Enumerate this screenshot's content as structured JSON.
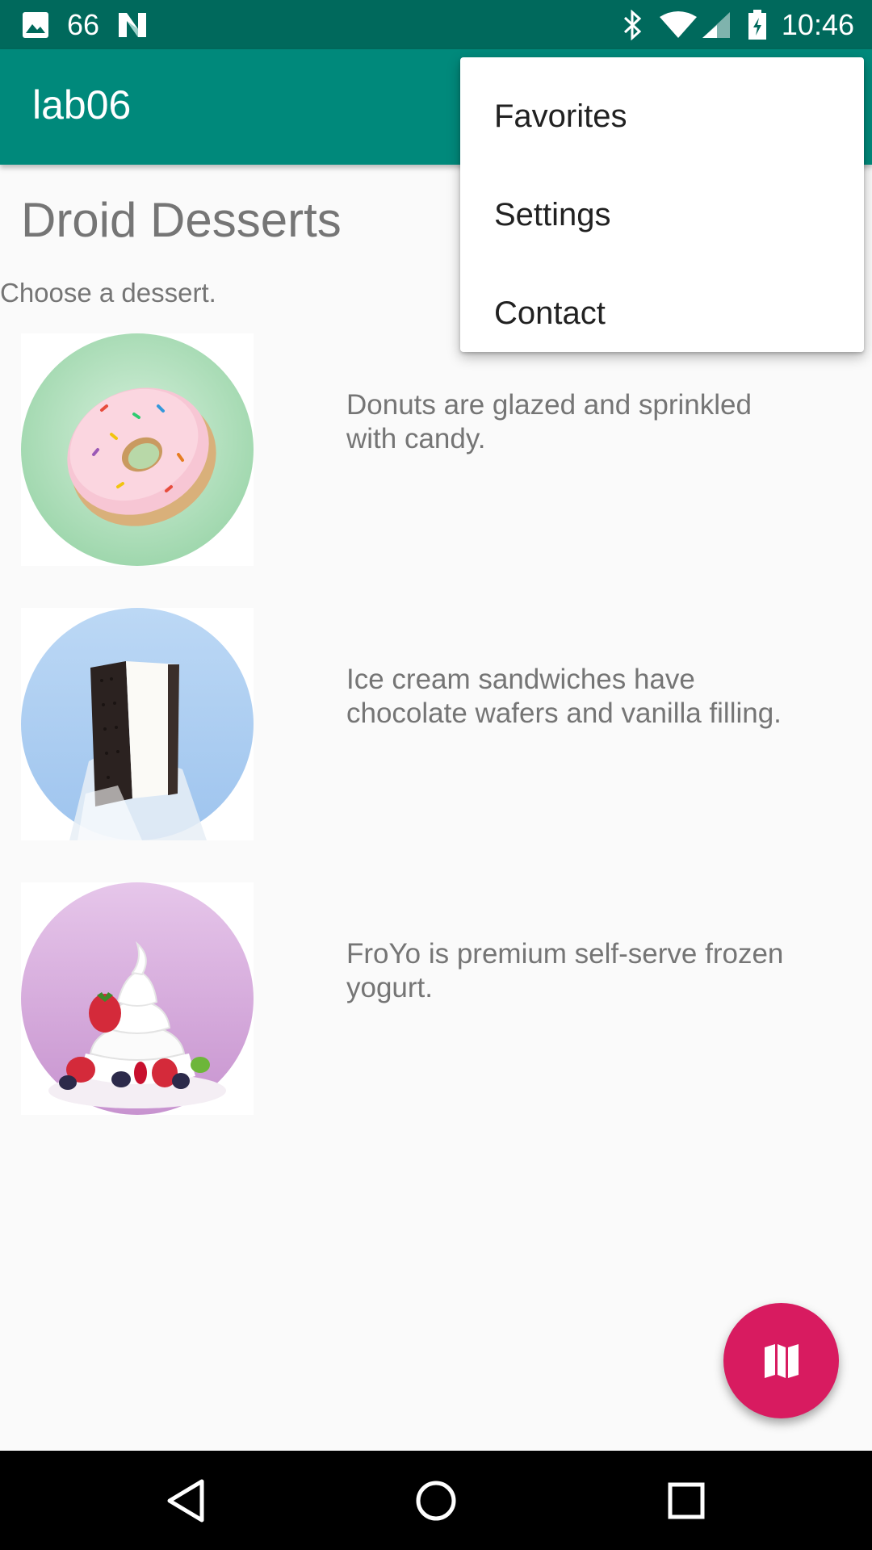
{
  "status_bar": {
    "notification_count": "66",
    "time": "10:46",
    "icons": [
      "image-icon",
      "n-icon",
      "bluetooth-icon",
      "wifi-icon",
      "cell-signal-icon",
      "battery-icon"
    ]
  },
  "app_bar": {
    "title": "lab06"
  },
  "main": {
    "title": "Droid Desserts",
    "subtitle": "Choose a dessert.",
    "desserts": [
      {
        "name": "donut",
        "description": "Donuts are glazed and sprinkled with candy."
      },
      {
        "name": "ice-cream-sandwich",
        "description": "Ice cream sandwiches have chocolate wafers and vanilla filling."
      },
      {
        "name": "froyo",
        "description": "FroYo is premium self-serve frozen yogurt."
      }
    ]
  },
  "overflow_menu": {
    "items": [
      {
        "label": "Favorites"
      },
      {
        "label": "Settings"
      },
      {
        "label": "Contact"
      }
    ]
  },
  "fab": {
    "icon": "map-icon",
    "color": "#d81b60"
  },
  "nav_bar": {
    "icons": [
      "back-icon",
      "home-icon",
      "recents-icon"
    ]
  },
  "colors": {
    "primary": "#00897b",
    "primary_dark": "#00695c",
    "accent": "#d81b60"
  }
}
